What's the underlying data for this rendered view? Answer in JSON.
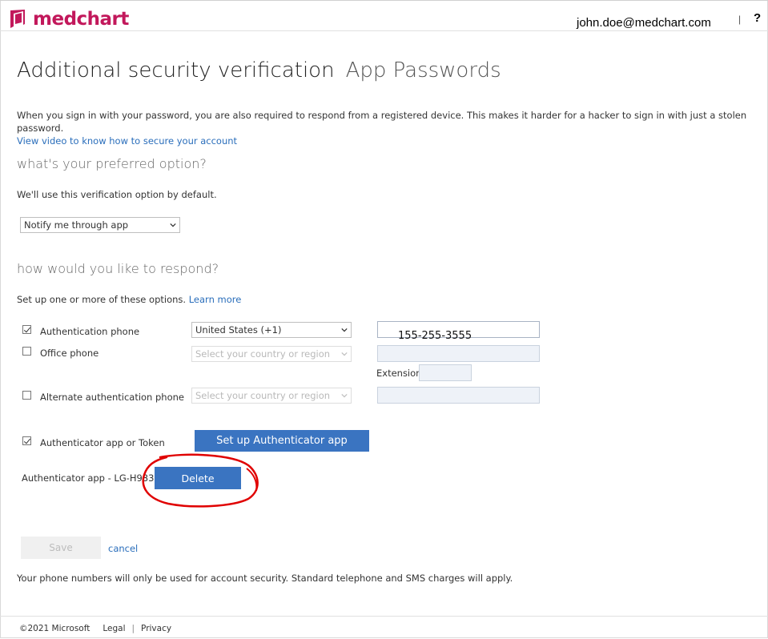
{
  "brand": {
    "name": "medchart",
    "color": "#c2185b"
  },
  "header": {
    "email": "john.doe@medchart.com",
    "separator": "|",
    "help": "?"
  },
  "page": {
    "title": "Additional security verification",
    "subtitle": "App Passwords",
    "description": "When you sign in with your password, you are also required to respond from a registered device. This makes it harder for a hacker to sign in with just a stolen password.",
    "video_link": "View video to know how to secure your account"
  },
  "preferred": {
    "heading": "what's your preferred option?",
    "help": "We'll use this verification option by default.",
    "selected": "Notify me through app"
  },
  "respond": {
    "heading": "how would you like to respond?",
    "help": "Set up one or more of these options.",
    "learn_more": "Learn more"
  },
  "options": {
    "auth_phone": {
      "label": "Authentication phone",
      "checked": true,
      "country": "United States (+1)",
      "number": "155-255-3555"
    },
    "office_phone": {
      "label": "Office phone",
      "checked": false,
      "country_placeholder": "Select your country or region",
      "extension_label": "Extension"
    },
    "alt_phone": {
      "label": "Alternate authentication phone",
      "checked": false,
      "country_placeholder": "Select your country or region"
    },
    "authenticator": {
      "label": "Authenticator app or Token",
      "checked": true,
      "setup_button": "Set up Authenticator app"
    }
  },
  "device": {
    "label": "Authenticator app - LG-H933",
    "delete_button": "Delete"
  },
  "actions": {
    "save": "Save",
    "cancel": "cancel"
  },
  "footer_note": "Your phone numbers will only be used for account security. Standard telephone and SMS charges will apply.",
  "footer": {
    "copyright": "©2021 Microsoft",
    "legal": "Legal",
    "privacy": "Privacy"
  },
  "colors": {
    "accent": "#3a74c1",
    "link": "#2a6ebb",
    "annotation": "#e00000"
  }
}
